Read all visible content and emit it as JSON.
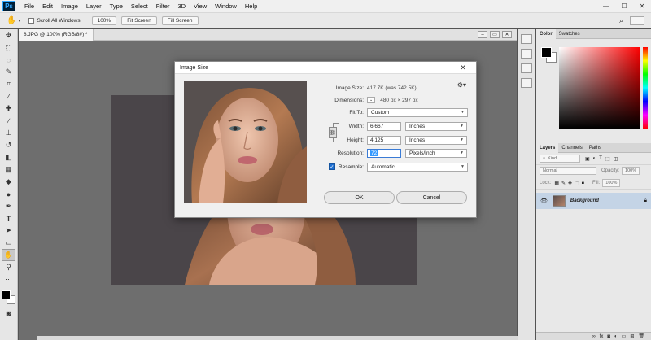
{
  "app": {
    "logo": "Ps",
    "menu": [
      "File",
      "Edit",
      "Image",
      "Layer",
      "Type",
      "Select",
      "Filter",
      "3D",
      "View",
      "Window",
      "Help"
    ],
    "window_controls": [
      "—",
      "☐",
      "✕"
    ]
  },
  "options_bar": {
    "scroll_all_label": "Scroll All Windows",
    "zoom_button": "100%",
    "fit_screen": "Fit Screen",
    "fill_screen": "Fill Screen"
  },
  "document": {
    "tab_title": "8.JPG @ 100% (RGB/8#) *"
  },
  "dialog": {
    "title": "Image Size",
    "image_size_label": "Image Size:",
    "image_size_value": "417.7K (was 742.5K)",
    "dimensions_label": "Dimensions:",
    "dimensions_value": "480 px  ×  297 px",
    "fit_to_label": "Fit To:",
    "fit_to_value": "Custom",
    "width_label": "Width:",
    "width_value": "6.667",
    "width_unit": "Inches",
    "height_label": "Height:",
    "height_value": "4.125",
    "height_unit": "Inches",
    "resolution_label": "Resolution:",
    "resolution_value": "72",
    "resolution_unit": "Pixels/Inch",
    "resample_label": "Resample:",
    "resample_value": "Automatic",
    "ok_label": "OK",
    "cancel_label": "Cancel"
  },
  "panels": {
    "color_tabs": [
      "Color",
      "Swatches"
    ],
    "layers_tabs": [
      "Layers",
      "Channels",
      "Paths"
    ],
    "kind_label": "Kind",
    "blend_mode": "Normal",
    "opacity_label": "Opacity:",
    "opacity_value": "100%",
    "lock_label": "Lock:",
    "fill_label": "Fill:",
    "fill_value": "100%",
    "layer_name": "Background"
  }
}
